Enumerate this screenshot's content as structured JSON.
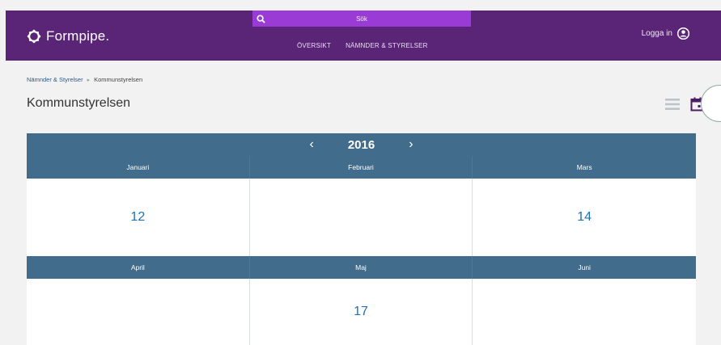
{
  "header": {
    "logo_text": "Formpipe.",
    "search_placeholder": "Sök",
    "nav": [
      "ÖVERSIKT",
      "NÄMNDER & STYRELSER"
    ],
    "login_label": "Logga in"
  },
  "breadcrumb": [
    "Nämnder & Styrelser",
    "Kommunstyrelsen"
  ],
  "page_title": "Kommunstyrelsen",
  "calendar": {
    "year": "2016",
    "months": [
      {
        "name": "Januari",
        "count": "12"
      },
      {
        "name": "Februari",
        "count": ""
      },
      {
        "name": "Mars",
        "count": "14"
      },
      {
        "name": "April",
        "count": ""
      },
      {
        "name": "Maj",
        "count": "17"
      },
      {
        "name": "Juni",
        "count": ""
      }
    ]
  },
  "colors": {
    "header": "#5b2577",
    "search": "#9b3bd6",
    "calendar_bar": "#416c8b",
    "count_link": "#1a72b8"
  },
  "icons": [
    "logo-icon",
    "search-icon",
    "user-icon",
    "list-view-icon",
    "calendar-view-icon",
    "chevron-left-icon",
    "chevron-right-icon"
  ]
}
